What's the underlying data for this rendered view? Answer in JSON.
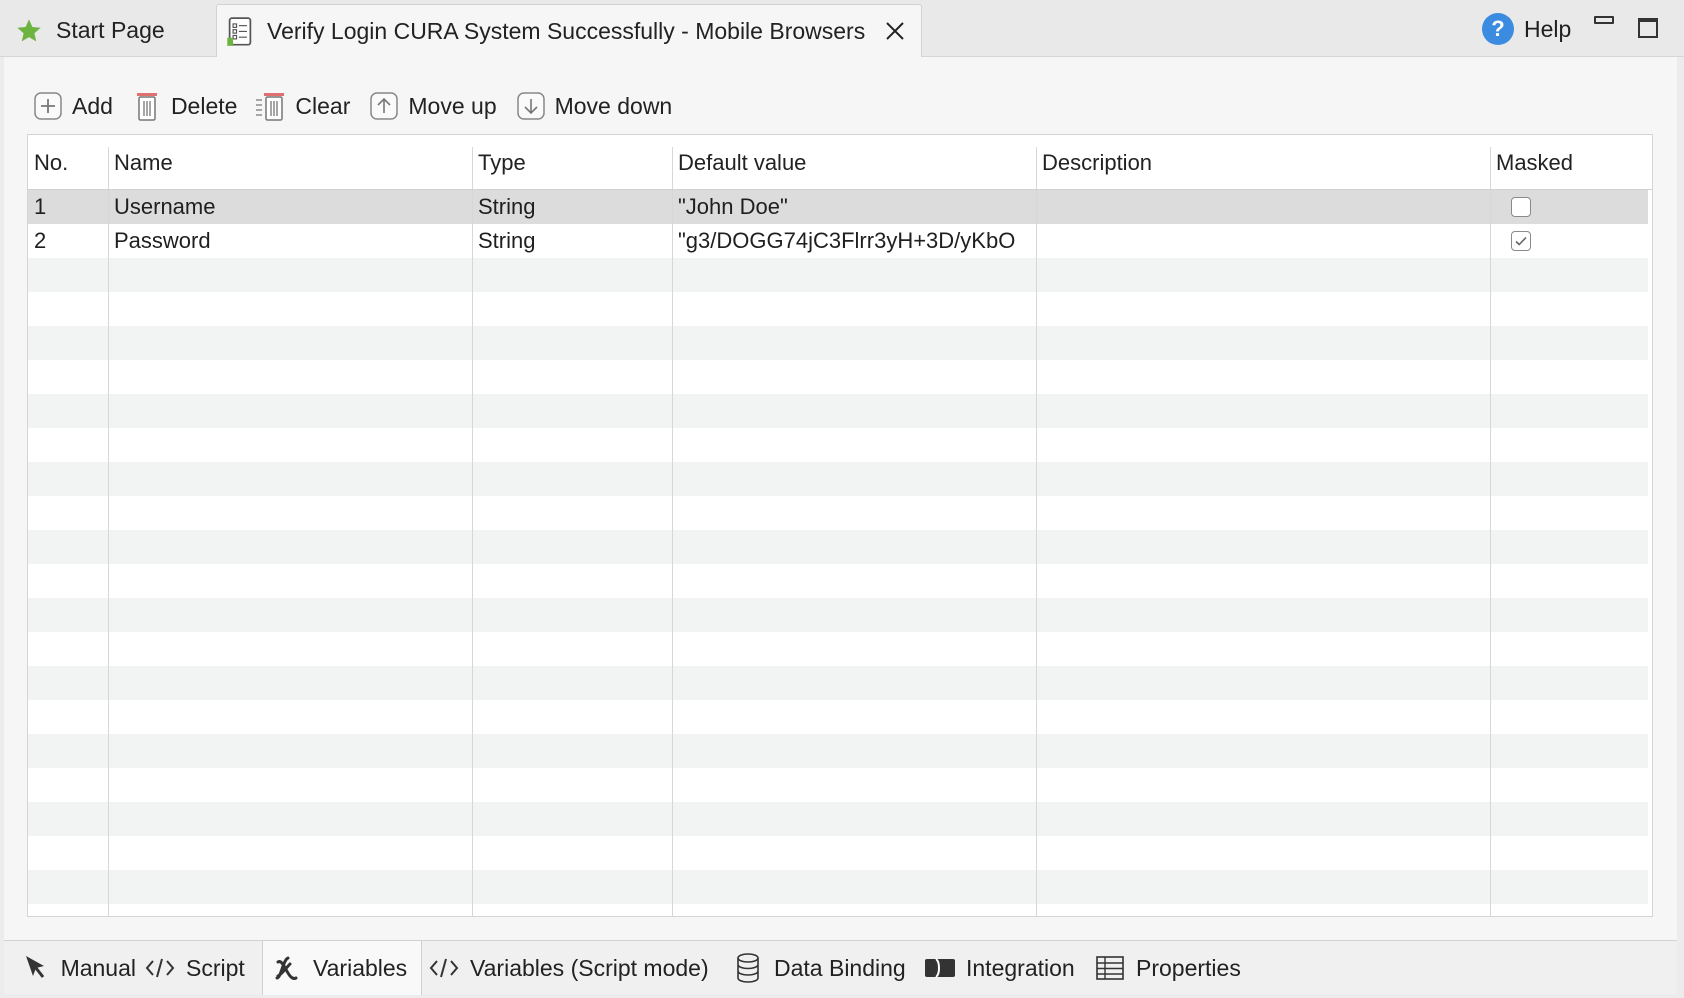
{
  "tabs": {
    "start_page": "Start Page",
    "active": "Verify Login CURA System Successfully - Mobile Browsers",
    "help": "Help"
  },
  "toolbar": {
    "add": "Add",
    "delete": "Delete",
    "clear": "Clear",
    "move_up": "Move up",
    "move_down": "Move down"
  },
  "table": {
    "headers": {
      "no": "No.",
      "name": "Name",
      "type": "Type",
      "default_value": "Default value",
      "description": "Description",
      "masked": "Masked"
    },
    "rows": [
      {
        "no": "1",
        "name": "Username",
        "type": "String",
        "default_value": "\"John Doe\"",
        "description": "",
        "masked": false
      },
      {
        "no": "2",
        "name": "Password",
        "type": "String",
        "default_value": "\"g3/DOGG74jC3Flrr3yH+3D/yKbO",
        "description": "",
        "masked": true
      }
    ]
  },
  "bottom_tabs": {
    "manual": "Manual",
    "script": "Script",
    "variables": "Variables",
    "variables_script": "Variables (Script mode)",
    "data_binding": "Data Binding",
    "integration": "Integration",
    "properties": "Properties"
  },
  "colors": {
    "star": "#6db33f",
    "help": "#3b8be0",
    "selected_row": "#dcdcdc",
    "alt_row": "#f2f4f4"
  }
}
